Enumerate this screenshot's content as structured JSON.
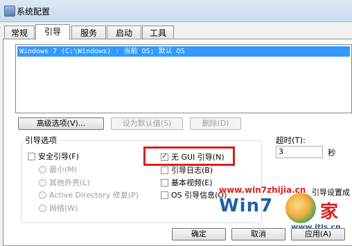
{
  "window": {
    "title": "系统配置"
  },
  "tabs": [
    {
      "label": "常规"
    },
    {
      "label": "引导"
    },
    {
      "label": "服务"
    },
    {
      "label": "启动"
    },
    {
      "label": "工具"
    }
  ],
  "os_list": {
    "items": [
      {
        "label": "Windows 7 (C:\\Windows) : 当前 OS; 默认 OS",
        "selected": true
      }
    ]
  },
  "buttons": {
    "advanced": "高级选项(V)...",
    "set_default": "设为默认值(S)",
    "delete": "删除(D)",
    "ok": "确定",
    "cancel": "取消",
    "apply": "应用(A)"
  },
  "boot_options": {
    "label": "引导选项",
    "safe_boot": {
      "label": "安全引导(F)",
      "checked": false
    },
    "minimal": "最小(M)",
    "alternate_shell": "其他外壳(L)",
    "ad_repair": "Active Directory 修复(P)",
    "network": "网络(W)",
    "no_gui": {
      "label": "无 GUI 引导(N)",
      "checked": true
    },
    "boot_log": {
      "label": "引导日志(B)",
      "checked": false
    },
    "base_video": {
      "label": "基本视频(E)",
      "checked": false
    },
    "os_boot_info": {
      "label": "OS 引导信息(O)",
      "checked": false
    }
  },
  "timeout": {
    "label": "超时(T):",
    "value": "3",
    "unit": "秒"
  },
  "partial": {
    "make_permanent": "引导设置成"
  },
  "watermark": {
    "site": "www.win7zhijia.cn",
    "brand": "Win7",
    "home": "家",
    "url": "www.itjs.cn"
  },
  "colors": {
    "selection": "#3399ff",
    "highlight_box": "#d81e1e",
    "watermark_red": "#d81e1e",
    "watermark_blue": "#1f5fa8"
  }
}
